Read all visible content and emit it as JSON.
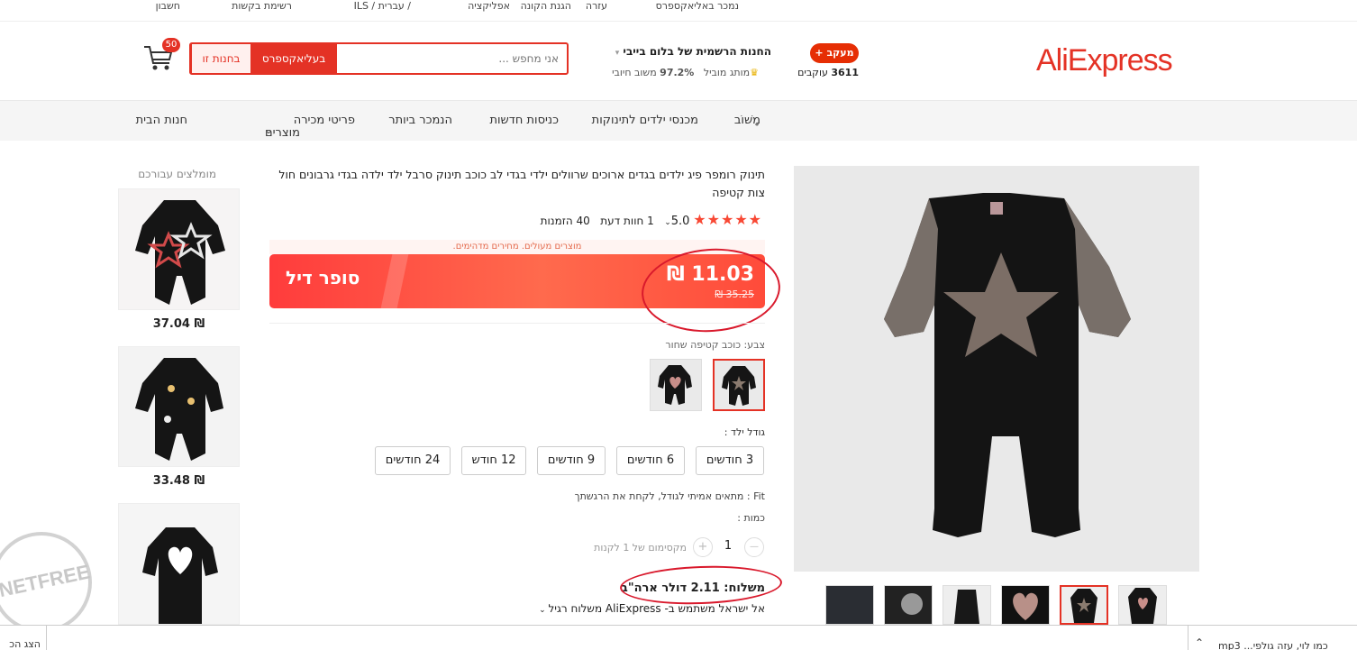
{
  "topbar": {
    "sell": "נמכר באליאקספרס",
    "help": "עזרה",
    "buyer_protection": "הגנת הקונה",
    "app": "אפליקציה",
    "lang_currency": "ILS / עברית /",
    "wishlist": "רשימת בקשות",
    "account": "חשבון"
  },
  "header": {
    "logo": "AliExpress",
    "follow_label": "+ מעקב",
    "followers_count": "3611",
    "followers_label": "עוקבים",
    "store_name": "החנות הרשמית של בלום בייבי",
    "top_brand": "מותג מוביל",
    "positive_rate": "97.2%",
    "positive_label": "משוב חיובי",
    "search_placeholder": "אני מחפש ...",
    "search_aliexpress": "בעליאקספרס",
    "search_store": "בחנות זו",
    "cart_count": "50"
  },
  "nav": {
    "items": [
      "מָשׁוֹב",
      "מכנסי ילדים לתינוקות",
      "כניסות חדשות",
      "הנמכר ביותר",
      "פריטי מכירה",
      "מוצרים",
      "חנות הבית"
    ]
  },
  "product": {
    "title": "תינוק רומפר פיג ילדים בגדים ארוכים שרוולים ילדי בגדי לב כוכב תינוק סרבל ילד ילדה בגדי גרבונים חול צות קטיפה",
    "rating": "5.0",
    "stars": "★★★★★",
    "reviews": "1 חוות דעת",
    "orders": "40 הזמנות",
    "promo_note": "מוצרים מעולים. מחירים מדהימים.",
    "price": "11.03 ₪",
    "old_price": "35.25 ₪",
    "deal_label": "סופר דיל",
    "color_label": "צבע: כוכב קטיפה שחור",
    "size_label": "גודל ילד :",
    "sizes": [
      "3 חודשים",
      "6 חודשים",
      "9 חודשים",
      "12 חודש",
      "24 חודשים"
    ],
    "fit_label": "Fit : מתאים אמיתי לגודל, לקחת את הרגשתך",
    "qty_label": "כמות :",
    "qty_value": "1",
    "qty_minus": "—",
    "qty_plus": "+",
    "qty_max": "מקסימום של 1 לקנות",
    "shipping": "משלוח: 2.11 דולר ארה\"ב",
    "shipping_detail": "אל ישראל משתמש ב- AliExpress משלוח רגיל"
  },
  "recommended": {
    "title": "מומלצים עבורכם",
    "items": [
      {
        "price": "37.04 ₪"
      },
      {
        "price": "33.48 ₪"
      }
    ]
  },
  "watermark": "NETFREE",
  "bottombar": {
    "right_text": "mp3 ...כמו לוי, עזה גולפי",
    "left_text": "הצג הכ"
  },
  "colors": {
    "accent": "#e43225",
    "annotation": "#d9192c"
  }
}
